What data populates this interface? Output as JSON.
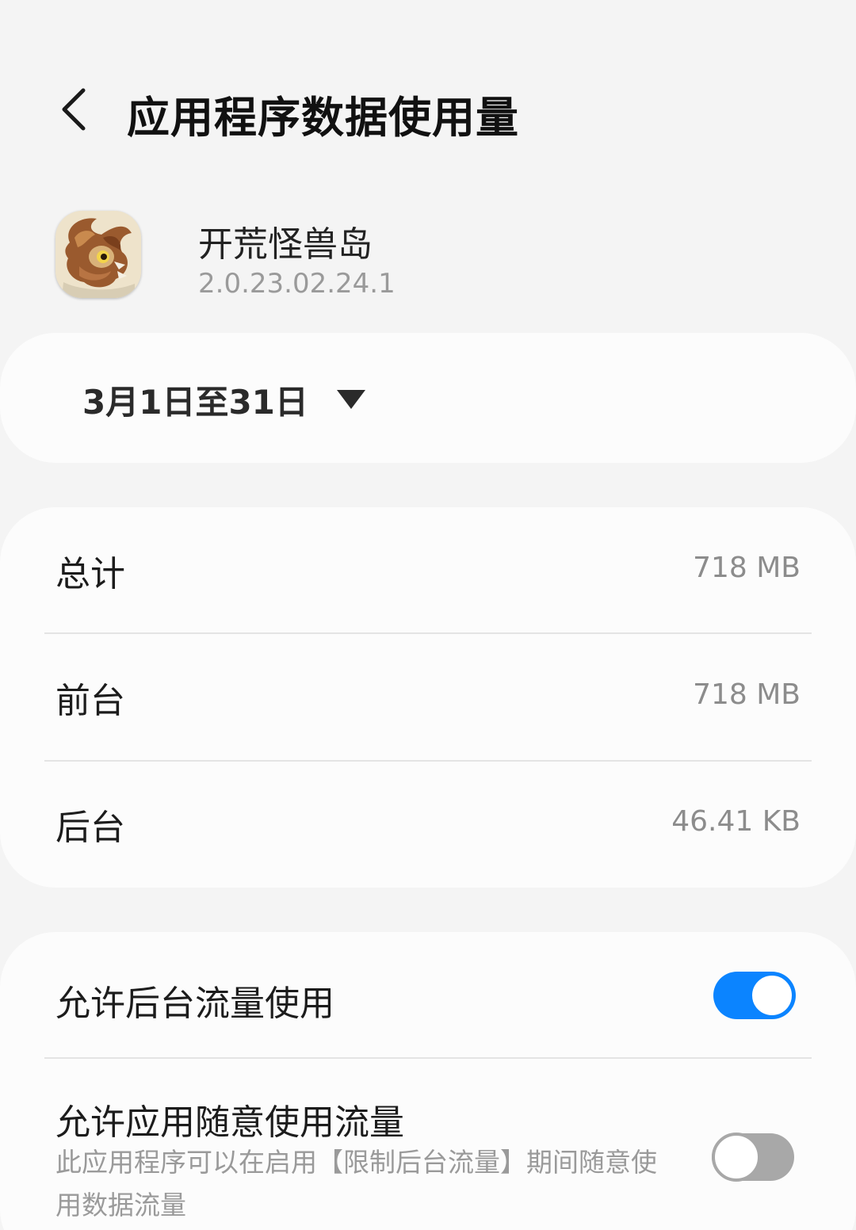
{
  "header": {
    "back_icon": "chevron-left-icon",
    "title": "应用程序数据使用量"
  },
  "app": {
    "name": "开荒怪兽岛",
    "version": "2.0.23.02.24.1",
    "icon": "dragon-app-icon"
  },
  "date_range": {
    "label": "3月1日至31日",
    "dropdown_icon": "triangle-down-icon"
  },
  "usage": {
    "total_label": "总计",
    "total_value": "718 MB",
    "foreground_label": "前台",
    "foreground_value": "718 MB",
    "background_label": "后台",
    "background_value": "46.41 KB"
  },
  "settings": {
    "background_data": {
      "label": "允许后台流量使用",
      "enabled": true
    },
    "unrestricted_data": {
      "label": "允许应用随意使用流量",
      "description": "此应用程序可以在启用【限制后台流量】期间随意使用数据流量",
      "enabled": false
    }
  },
  "colors": {
    "accent": "#0b84ff",
    "background": "#f4f4f4",
    "card": "#fcfcfc",
    "secondary_text": "#9a9a9a"
  }
}
